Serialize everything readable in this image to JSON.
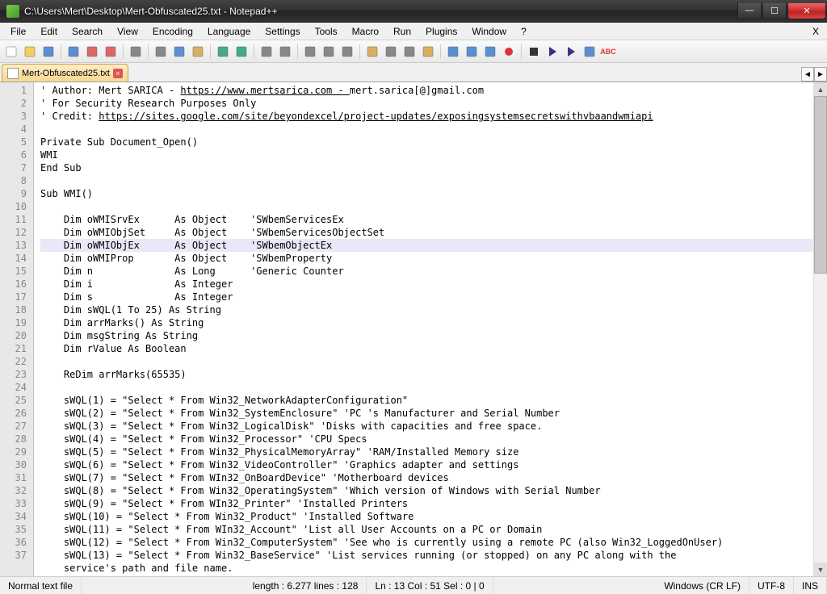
{
  "window": {
    "title": "C:\\Users\\Mert\\Desktop\\Mert-Obfuscated25.txt - Notepad++",
    "buttons": {
      "min": "—",
      "max": "☐",
      "close": "✕"
    }
  },
  "menu": {
    "items": [
      "File",
      "Edit",
      "Search",
      "View",
      "Encoding",
      "Language",
      "Settings",
      "Tools",
      "Macro",
      "Run",
      "Plugins",
      "Window",
      "?"
    ],
    "close_x": "X"
  },
  "toolbar_icons": [
    "new",
    "open",
    "save",
    "save-all",
    "close",
    "close-all",
    "print",
    "cut",
    "copy",
    "paste",
    "undo",
    "redo",
    "find",
    "replace",
    "zoom-in",
    "zoom-out",
    "sync",
    "word-wrap",
    "all-chars",
    "indent",
    "folder",
    "doc-map",
    "func-list",
    "monitor",
    "record",
    "stop",
    "play",
    "play-multi",
    "macro-save",
    "abc-spell"
  ],
  "tab": {
    "filename": "Mert-Obfuscated25.txt",
    "close": "×"
  },
  "tab_nav": {
    "left": "◄",
    "right": "►"
  },
  "code_lines": [
    {
      "n": 1,
      "t": "' Author: Mert SARICA - https://www.mertsarica.com - mert.sarica[@]gmail.com",
      "link": [
        24,
        53
      ]
    },
    {
      "n": 2,
      "t": "' For Security Research Purposes Only"
    },
    {
      "n": 3,
      "t": "' Credit: https://sites.google.com/site/beyondexcel/project-updates/exposingsystemsecretswithvbaandwmiapi",
      "link": [
        10,
        107
      ]
    },
    {
      "n": 4,
      "t": ""
    },
    {
      "n": 5,
      "t": "Private Sub Document_Open()"
    },
    {
      "n": 6,
      "t": "WMI"
    },
    {
      "n": 7,
      "t": "End Sub"
    },
    {
      "n": 8,
      "t": ""
    },
    {
      "n": 9,
      "t": "Sub WMI()"
    },
    {
      "n": 10,
      "t": ""
    },
    {
      "n": 11,
      "t": "    Dim oWMISrvEx      As Object    'SWbemServicesEx"
    },
    {
      "n": 12,
      "t": "    Dim oWMIObjSet     As Object    'SWbemServicesObjectSet"
    },
    {
      "n": 13,
      "t": "    Dim oWMIObjEx      As Object    'SWbemObjectEx",
      "hl": true
    },
    {
      "n": 14,
      "t": "    Dim oWMIProp       As Object    'SWbemProperty"
    },
    {
      "n": 15,
      "t": "    Dim n              As Long      'Generic Counter"
    },
    {
      "n": 16,
      "t": "    Dim i              As Integer"
    },
    {
      "n": 17,
      "t": "    Dim s              As Integer"
    },
    {
      "n": 18,
      "t": "    Dim sWQL(1 To 25) As String"
    },
    {
      "n": 19,
      "t": "    Dim arrMarks() As String"
    },
    {
      "n": 20,
      "t": "    Dim msgString As String"
    },
    {
      "n": 21,
      "t": "    Dim rValue As Boolean"
    },
    {
      "n": 22,
      "t": ""
    },
    {
      "n": 23,
      "t": "    ReDim arrMarks(65535)"
    },
    {
      "n": 24,
      "t": ""
    },
    {
      "n": 25,
      "t": "    sWQL(1) = \"Select * From Win32_NetworkAdapterConfiguration\""
    },
    {
      "n": 26,
      "t": "    sWQL(2) = \"Select * From Win32_SystemEnclosure\" 'PC 's Manufacturer and Serial Number"
    },
    {
      "n": 27,
      "t": "    sWQL(3) = \"Select * From Win32_LogicalDisk\" 'Disks with capacities and free space."
    },
    {
      "n": 28,
      "t": "    sWQL(4) = \"Select * From Win32_Processor\" 'CPU Specs"
    },
    {
      "n": 29,
      "t": "    sWQL(5) = \"Select * From Win32_PhysicalMemoryArray\" 'RAM/Installed Memory size"
    },
    {
      "n": 30,
      "t": "    sWQL(6) = \"Select * From Win32_VideoController\" 'Graphics adapter and settings"
    },
    {
      "n": 31,
      "t": "    sWQL(7) = \"Select * From WIn32_OnBoardDevice\" 'Motherboard devices"
    },
    {
      "n": 32,
      "t": "    sWQL(8) = \"Select * From Win32_OperatingSystem\" 'Which version of Windows with Serial Number"
    },
    {
      "n": 33,
      "t": "    sWQL(9) = \"Select * From WIn32_Printer\" 'Installed Printers"
    },
    {
      "n": 34,
      "t": "    sWQL(10) = \"Select * From Win32_Product\" 'Installed Software"
    },
    {
      "n": 35,
      "t": "    sWQL(11) = \"Select * From WIn32_Account\" 'List all User Accounts on a PC or Domain"
    },
    {
      "n": 36,
      "t": "    sWQL(12) = \"Select * From Win32_ComputerSystem\" 'See who is currently using a remote PC (also Win32_LoggedOnUser)"
    },
    {
      "n": 37,
      "t": "    sWQL(13) = \"Select * From Win32_BaseService\" 'List services running (or stopped) on any PC along with the"
    },
    {
      "n": 0,
      "t": "    service's path and file name."
    }
  ],
  "status": {
    "filetype": "Normal text file",
    "length": "length : 6.277    lines : 128",
    "pos": "Ln : 13    Col : 51    Sel : 0 | 0",
    "eol": "Windows (CR LF)",
    "enc": "UTF-8",
    "ins": "INS"
  }
}
